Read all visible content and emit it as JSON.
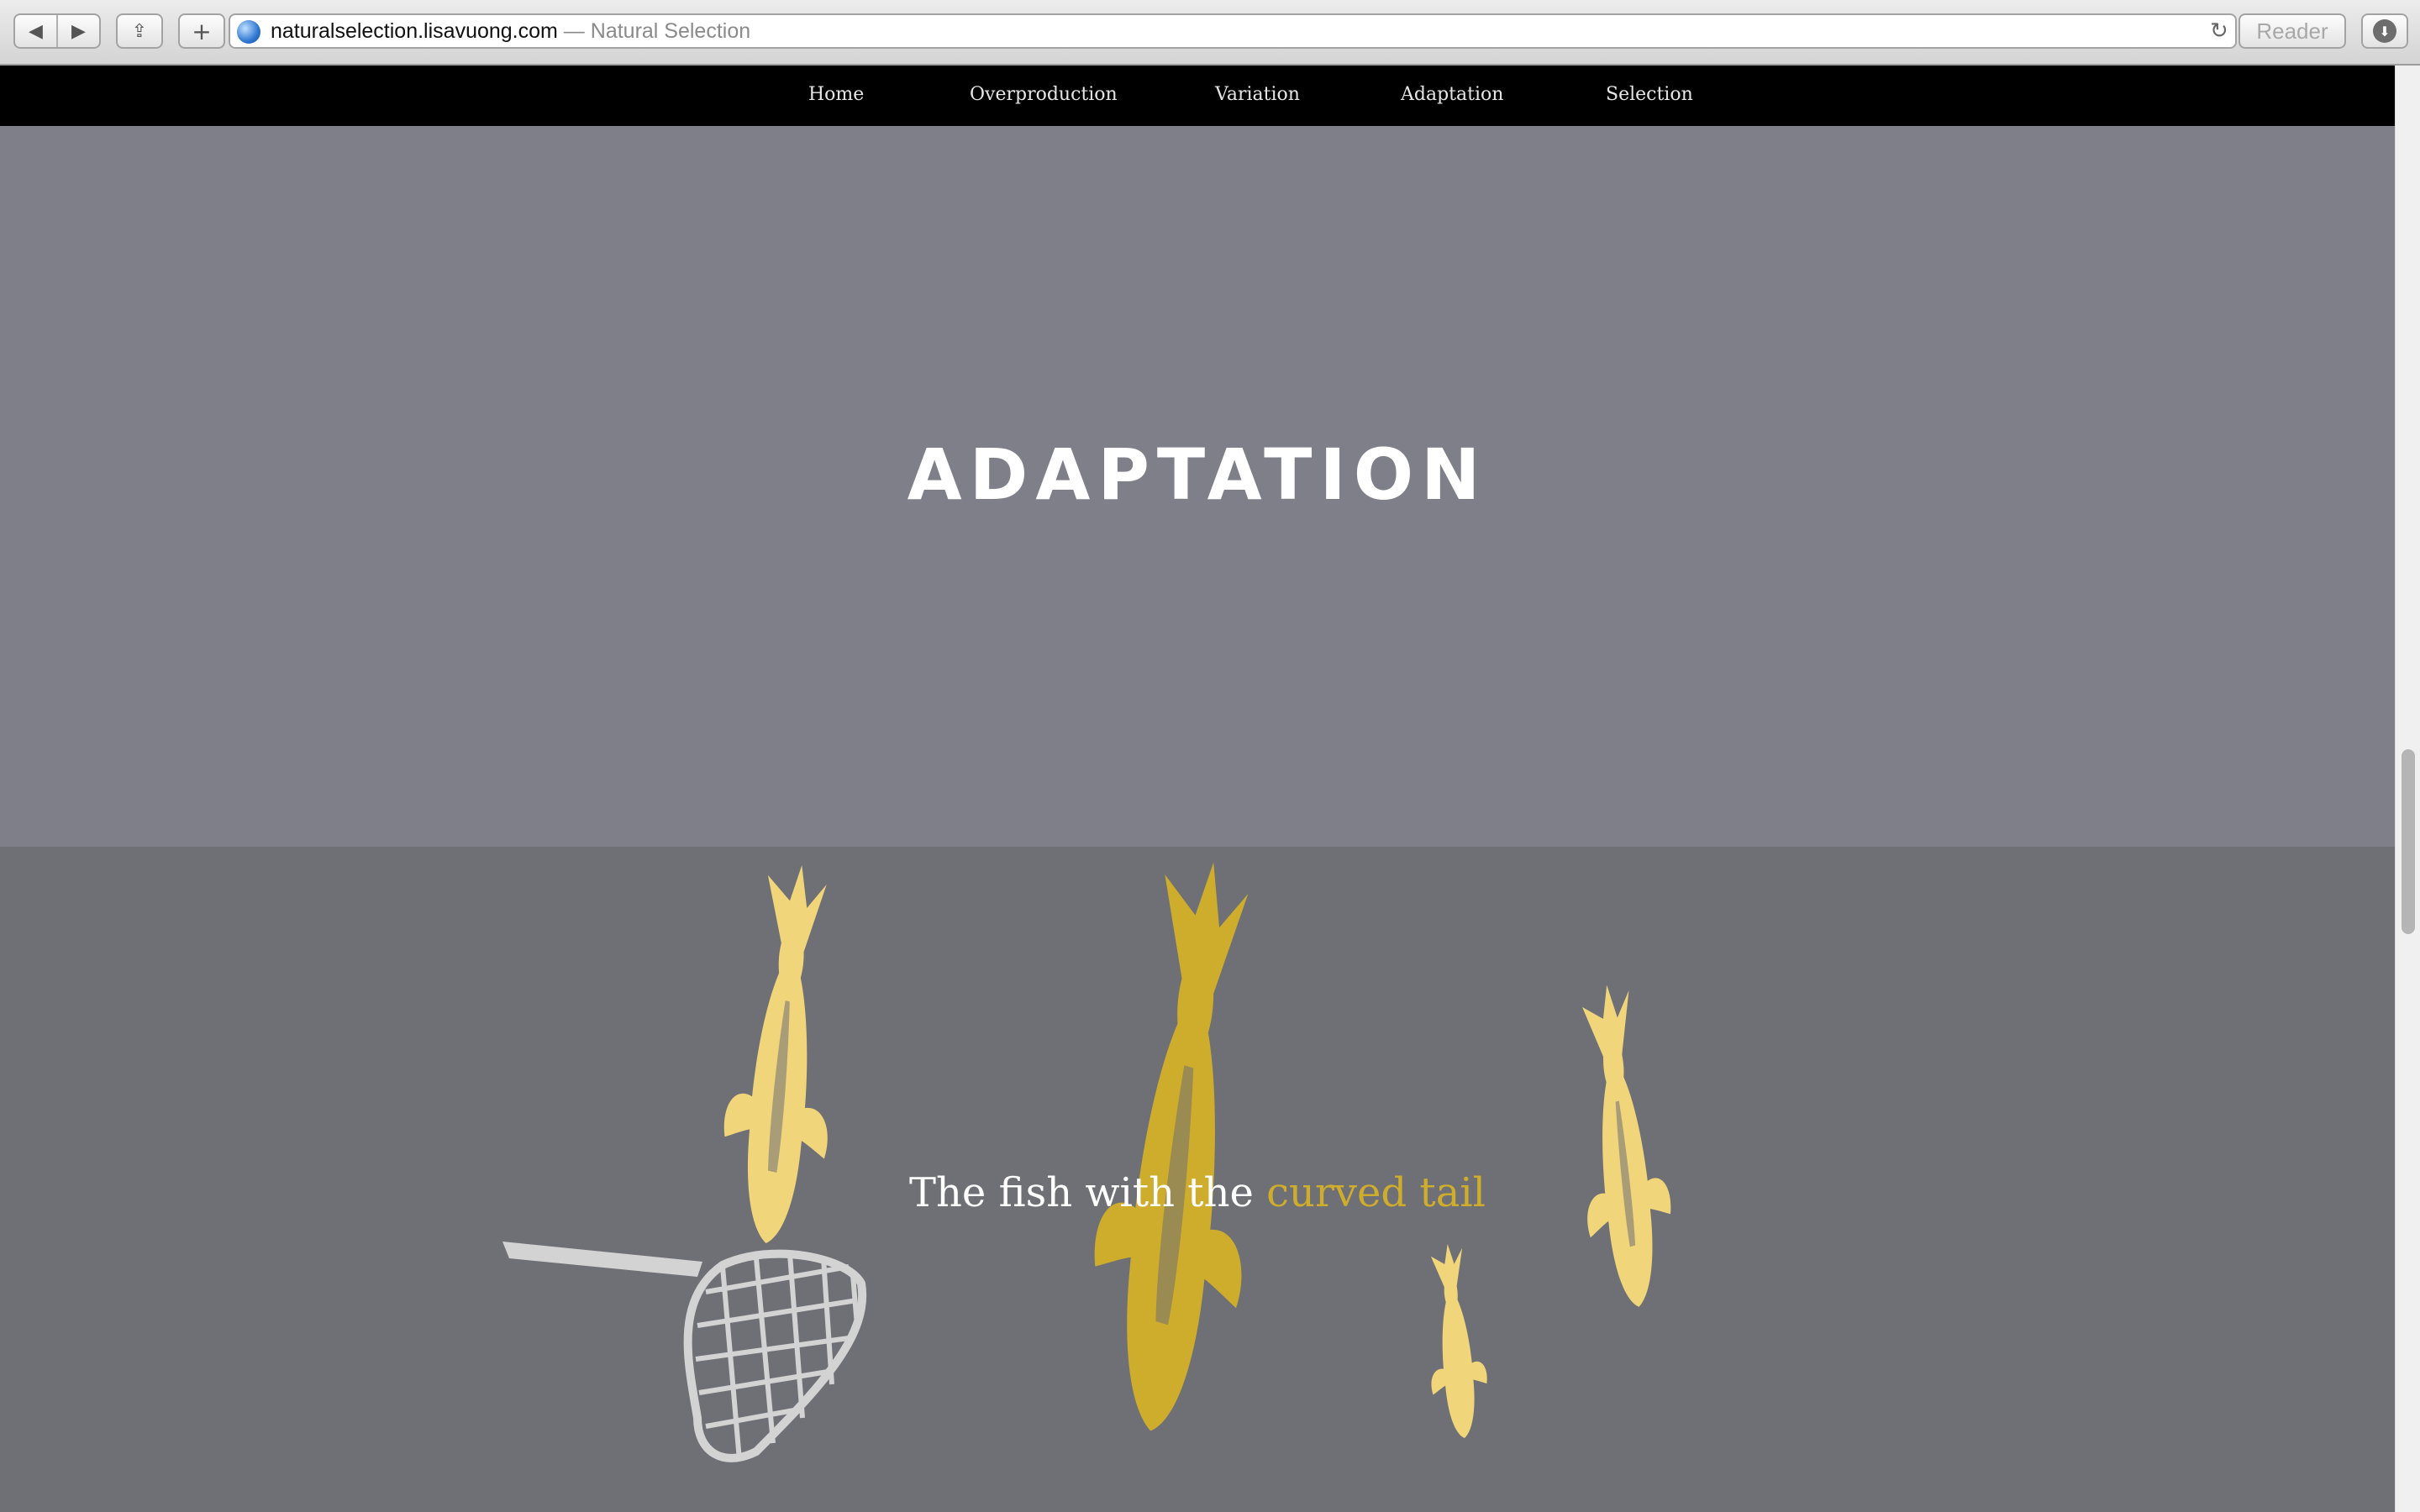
{
  "browser": {
    "url": "naturalselection.lisavuong.com",
    "separator": " — ",
    "page_title": "Natural Selection",
    "reader_label": "Reader",
    "back_glyph": "◀",
    "forward_glyph": "▶",
    "share_glyph": "⇪",
    "add_glyph": "+",
    "reload_glyph": "↻",
    "download_glyph": "⬇"
  },
  "nav": {
    "items": [
      {
        "label": "Home"
      },
      {
        "label": "Overproduction"
      },
      {
        "label": "Variation"
      },
      {
        "label": "Adaptation"
      },
      {
        "label": "Selection"
      }
    ]
  },
  "hero": {
    "title": "ADAPTATION"
  },
  "scene": {
    "caption_prefix": "The fish with the ",
    "caption_highlight": "curved tail",
    "colors": {
      "pale_fish": "#f0d57b",
      "gold_fish": "#cfad2c",
      "net": "#d3d3d3",
      "hero_bg": "#7e7f89",
      "scene_bg": "#6f7075"
    }
  }
}
